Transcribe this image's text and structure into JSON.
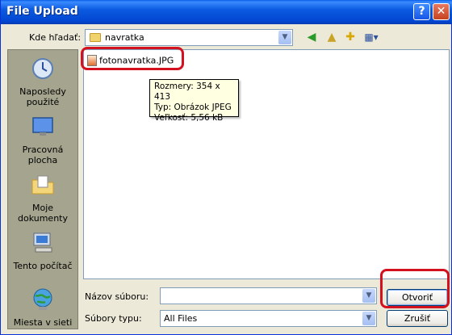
{
  "window": {
    "title": "File Upload"
  },
  "titlebar": {
    "help_label": "?",
    "close_label": "✕"
  },
  "lookin": {
    "label": "Kde hľadať:",
    "value": "navratka"
  },
  "places": [
    {
      "label": "Naposledy použité",
      "icon": "recent-icon"
    },
    {
      "label": "Pracovná plocha",
      "icon": "desktop-icon"
    },
    {
      "label": "Moje dokumenty",
      "icon": "my-documents-icon"
    },
    {
      "label": "Tento počítač",
      "icon": "my-computer-icon"
    },
    {
      "label": "Miesta v sieti",
      "icon": "network-places-icon"
    }
  ],
  "files": [
    {
      "name": "fotonavratka.JPG",
      "icon": "jpeg-file-icon"
    }
  ],
  "tooltip": {
    "line1": "Rozmery: 354 x 413",
    "line2": "Typ: Obrázok JPEG",
    "line3": "Veľkosť: 5,56 kB"
  },
  "filename": {
    "label": "Názov súboru:",
    "value": ""
  },
  "filetype": {
    "label": "Súbory typu:",
    "value": "All Files"
  },
  "buttons": {
    "open": "Otvoriť",
    "cancel": "Zrušiť"
  },
  "colors": {
    "titlebar": "#0b5ae0",
    "highlight": "#d4111f",
    "tooltip": "#ffffe1",
    "places_bg": "#a5a58f"
  }
}
